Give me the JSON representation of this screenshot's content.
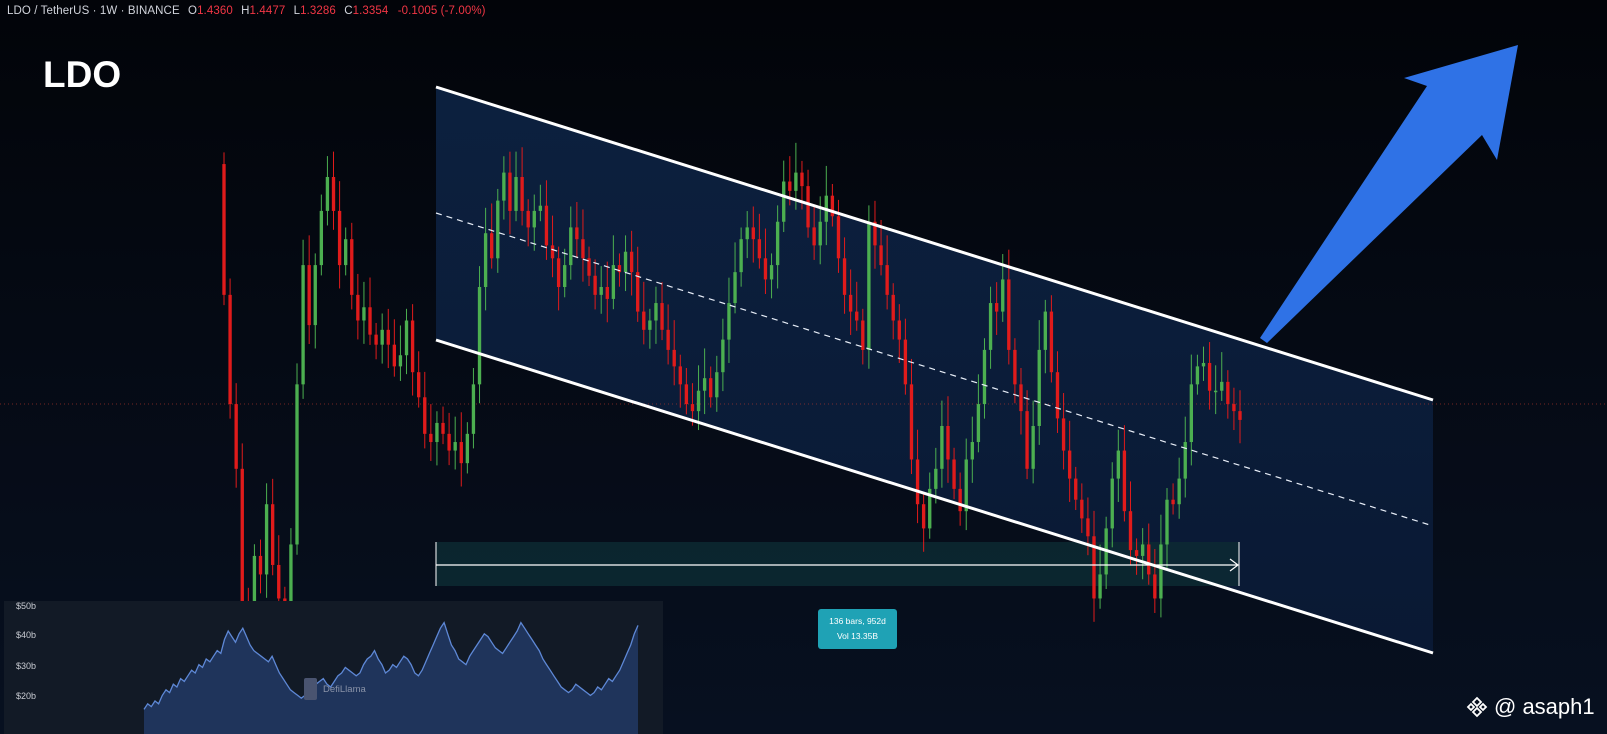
{
  "header": {
    "symbol": "LDO / TetherUS",
    "interval": "1W",
    "exchange": "BINANCE",
    "o_label": "O",
    "o_value": "1.4360",
    "h_label": "H",
    "h_value": "1.4477",
    "l_label": "L",
    "l_value": "1.3286",
    "c_label": "C",
    "c_value": "1.3354",
    "change": "-0.1005 (-7.00%)"
  },
  "title": "LDO",
  "measure": {
    "bars": "136 bars, 952d",
    "vol": "Vol 13.35B"
  },
  "watermark": {
    "handle": "@ asaph1"
  },
  "inset": {
    "brand": "DefiLlama",
    "y_labels": [
      "$50b",
      "$40b",
      "$30b",
      "$20b"
    ],
    "series_values": [
      17,
      19,
      18,
      20,
      19,
      22,
      24,
      23,
      26,
      25,
      28,
      27,
      29,
      31,
      30,
      33,
      32,
      35,
      34,
      36,
      38,
      37,
      42,
      45,
      43,
      41,
      44,
      46,
      43,
      40,
      38,
      37,
      36,
      35,
      34,
      36,
      33,
      30,
      28,
      26,
      24,
      23,
      22,
      21,
      22,
      23,
      25,
      26,
      27,
      28,
      26,
      25,
      27,
      29,
      30,
      32,
      31,
      30,
      29,
      30,
      33,
      35,
      36,
      38,
      35,
      33,
      30,
      31,
      33,
      32,
      34,
      36,
      35,
      33,
      30,
      29,
      31,
      34,
      37,
      40,
      43,
      46,
      48,
      44,
      40,
      38,
      35,
      34,
      33,
      36,
      38,
      40,
      42,
      44,
      43,
      41,
      39,
      38,
      37,
      39,
      41,
      43,
      45,
      48,
      46,
      44,
      42,
      40,
      38,
      35,
      33,
      31,
      29,
      27,
      25,
      24,
      23,
      24,
      26,
      25,
      24,
      23,
      22,
      23,
      25,
      24,
      26,
      28,
      27,
      29,
      31,
      34,
      37,
      40,
      44,
      47
    ]
  },
  "colors": {
    "up": "#4caf50",
    "down": "#e01b1b",
    "arrow": "#2f72e6",
    "channel_fill": "#0e1f3d",
    "measure": "#1fa2b5"
  },
  "chart_data": {
    "type": "candlestick",
    "title": "LDO",
    "symbol": "LDO / TetherUS",
    "interval": "1W",
    "exchange": "BINANCE",
    "ohlc_last": {
      "open": 1.436,
      "high": 1.4477,
      "low": 1.3286,
      "close": 1.3354,
      "change": -0.1005,
      "change_pct": -7.0
    },
    "y_scale": {
      "top": 7.3,
      "bottom": 0.3,
      "log": true
    },
    "candles": [
      [
        4.8,
        2.5
      ],
      [
        2.5,
        1.45
      ],
      [
        1.45,
        1.05
      ],
      [
        1.05,
        0.5
      ],
      [
        0.5,
        0.42
      ],
      [
        0.42,
        0.68
      ],
      [
        0.68,
        0.62
      ],
      [
        0.62,
        0.88
      ],
      [
        0.88,
        0.65
      ],
      [
        0.65,
        0.55
      ],
      [
        0.55,
        0.44
      ],
      [
        0.44,
        0.72
      ],
      [
        0.72,
        1.6
      ],
      [
        1.6,
        2.9
      ],
      [
        2.9,
        2.15
      ],
      [
        2.15,
        2.9
      ],
      [
        2.9,
        3.8
      ],
      [
        3.8,
        4.5
      ],
      [
        4.5,
        3.8
      ],
      [
        3.8,
        2.9
      ],
      [
        2.9,
        3.3
      ],
      [
        3.3,
        2.5
      ],
      [
        2.5,
        2.2
      ],
      [
        2.2,
        2.35
      ],
      [
        2.35,
        2.05
      ],
      [
        2.05,
        1.95
      ],
      [
        1.95,
        2.1
      ],
      [
        2.1,
        1.95
      ],
      [
        1.95,
        1.75
      ],
      [
        1.75,
        1.85
      ],
      [
        1.85,
        2.2
      ],
      [
        2.2,
        1.7
      ],
      [
        1.7,
        1.5
      ],
      [
        1.5,
        1.25
      ],
      [
        1.25,
        1.2
      ],
      [
        1.2,
        1.32
      ],
      [
        1.32,
        1.25
      ],
      [
        1.25,
        1.15
      ],
      [
        1.15,
        1.2
      ],
      [
        1.2,
        1.08
      ],
      [
        1.08,
        1.25
      ],
      [
        1.25,
        1.6
      ],
      [
        1.6,
        2.6
      ],
      [
        2.6,
        3.4
      ],
      [
        3.4,
        3.0
      ],
      [
        3.0,
        4.0
      ],
      [
        4.0,
        4.6
      ],
      [
        4.6,
        3.8
      ],
      [
        3.8,
        4.5
      ],
      [
        4.5,
        3.8
      ],
      [
        3.8,
        3.5
      ],
      [
        3.5,
        3.8
      ],
      [
        3.8,
        3.9
      ],
      [
        3.9,
        3.2
      ],
      [
        3.2,
        3.0
      ],
      [
        3.0,
        2.6
      ],
      [
        2.6,
        2.9
      ],
      [
        2.9,
        3.5
      ],
      [
        3.5,
        3.3
      ],
      [
        3.3,
        3.0
      ],
      [
        3.0,
        2.75
      ],
      [
        2.75,
        2.5
      ],
      [
        2.5,
        2.6
      ],
      [
        2.6,
        2.45
      ],
      [
        2.45,
        2.9
      ],
      [
        2.9,
        2.8
      ],
      [
        2.8,
        3.1
      ],
      [
        3.1,
        2.8
      ],
      [
        2.8,
        2.3
      ],
      [
        2.3,
        2.1
      ],
      [
        2.1,
        2.2
      ],
      [
        2.2,
        2.4
      ],
      [
        2.4,
        2.1
      ],
      [
        2.1,
        1.9
      ],
      [
        1.9,
        1.75
      ],
      [
        1.75,
        1.6
      ],
      [
        1.6,
        1.45
      ],
      [
        1.45,
        1.4
      ],
      [
        1.4,
        1.55
      ],
      [
        1.55,
        1.65
      ],
      [
        1.65,
        1.5
      ],
      [
        1.5,
        1.7
      ],
      [
        1.7,
        2.0
      ],
      [
        2.0,
        2.4
      ],
      [
        2.4,
        2.8
      ],
      [
        2.8,
        3.3
      ],
      [
        3.3,
        3.5
      ],
      [
        3.5,
        3.3
      ],
      [
        3.3,
        3.0
      ],
      [
        3.0,
        2.7
      ],
      [
        2.7,
        2.9
      ],
      [
        2.9,
        3.6
      ],
      [
        3.6,
        4.4
      ],
      [
        4.4,
        4.2
      ],
      [
        4.2,
        4.6
      ],
      [
        4.6,
        4.3
      ],
      [
        4.3,
        3.5
      ],
      [
        3.5,
        3.2
      ],
      [
        3.2,
        3.6
      ],
      [
        3.6,
        4.1
      ],
      [
        4.1,
        3.7
      ],
      [
        3.7,
        3.0
      ],
      [
        3.0,
        2.5
      ],
      [
        2.5,
        2.3
      ],
      [
        2.3,
        2.2
      ],
      [
        2.2,
        1.9
      ],
      [
        1.9,
        3.6
      ],
      [
        3.6,
        3.2
      ],
      [
        3.2,
        2.9
      ],
      [
        2.9,
        2.5
      ],
      [
        2.5,
        2.2
      ],
      [
        2.2,
        2.0
      ],
      [
        2.0,
        1.6
      ],
      [
        1.6,
        1.1
      ],
      [
        1.1,
        0.88
      ],
      [
        0.88,
        0.78
      ],
      [
        0.78,
        0.95
      ],
      [
        0.95,
        1.05
      ],
      [
        1.05,
        1.3
      ],
      [
        1.3,
        1.1
      ],
      [
        1.1,
        0.95
      ],
      [
        0.95,
        0.85
      ],
      [
        0.85,
        1.1
      ],
      [
        1.1,
        1.2
      ],
      [
        1.2,
        1.45
      ],
      [
        1.45,
        1.9
      ],
      [
        1.9,
        2.4
      ],
      [
        2.4,
        2.3
      ],
      [
        2.3,
        2.7
      ],
      [
        2.7,
        1.9
      ],
      [
        1.9,
        1.6
      ],
      [
        1.6,
        1.4
      ],
      [
        1.4,
        1.05
      ],
      [
        1.05,
        1.3
      ],
      [
        1.3,
        1.9
      ],
      [
        1.9,
        2.3
      ],
      [
        2.3,
        1.7
      ],
      [
        1.7,
        1.35
      ],
      [
        1.35,
        1.15
      ],
      [
        1.15,
        1.0
      ],
      [
        1.0,
        0.9
      ],
      [
        0.9,
        0.82
      ],
      [
        0.82,
        0.75
      ],
      [
        0.75,
        0.55
      ],
      [
        0.55,
        0.62
      ],
      [
        0.62,
        0.78
      ],
      [
        0.78,
        1.0
      ],
      [
        1.0,
        1.15
      ],
      [
        1.15,
        0.85
      ],
      [
        0.85,
        0.7
      ],
      [
        0.7,
        0.68
      ],
      [
        0.68,
        0.72
      ],
      [
        0.72,
        0.62
      ],
      [
        0.62,
        0.55
      ],
      [
        0.55,
        0.72
      ],
      [
        0.72,
        0.9
      ],
      [
        0.9,
        0.88
      ],
      [
        0.88,
        1.0
      ],
      [
        1.0,
        1.2
      ],
      [
        1.2,
        1.6
      ],
      [
        1.6,
        1.75
      ],
      [
        1.75,
        1.78
      ],
      [
        1.78,
        1.55
      ],
      [
        1.55,
        1.55
      ],
      [
        1.55,
        1.62
      ],
      [
        1.62,
        1.45
      ],
      [
        1.45,
        1.4
      ],
      [
        1.4,
        1.34
      ]
    ],
    "annotations": {
      "channel": "descending parallel channel",
      "measure": "136 bars, 952d, Vol 13.35B",
      "arrow": "breakout projection up"
    }
  }
}
